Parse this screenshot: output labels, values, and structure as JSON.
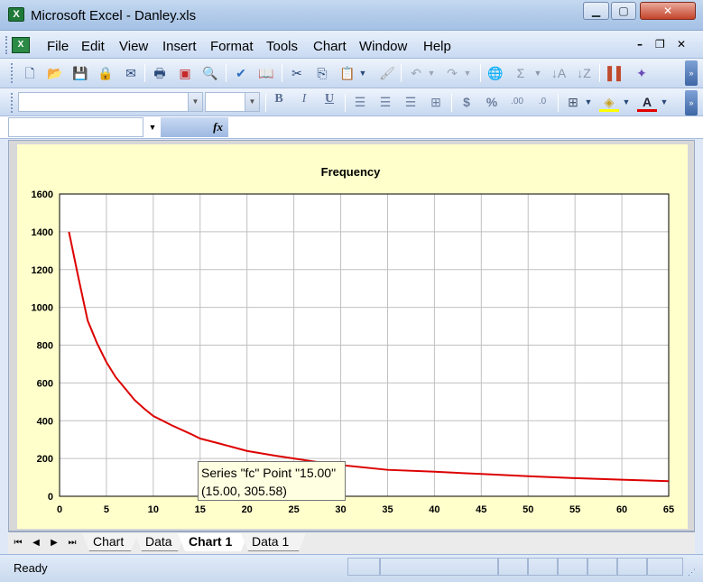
{
  "window": {
    "title": "Microsoft Excel - Danley.xls",
    "app_icon_glyph": "X"
  },
  "menu": {
    "items": [
      {
        "label": "File"
      },
      {
        "label": "Edit"
      },
      {
        "label": "View"
      },
      {
        "label": "Insert"
      },
      {
        "label": "Format"
      },
      {
        "label": "Tools"
      },
      {
        "label": "Chart"
      },
      {
        "label": "Window"
      },
      {
        "label": "Help"
      }
    ]
  },
  "formula_bar": {
    "name_box": "",
    "fx_label": "fx",
    "formula": ""
  },
  "toolbar": {
    "font_name": "",
    "font_size": "",
    "bold": "B",
    "italic": "I",
    "underline": "U",
    "currency": "$",
    "percent": "%",
    "increase_decimal": ".00",
    "decrease_decimal": ".0"
  },
  "tooltip": {
    "line1": "Series \"fc\" Point \"15.00\"",
    "line2": "(15.00, 305.58)"
  },
  "tabs": [
    {
      "label": "Chart",
      "active": false
    },
    {
      "label": "Data",
      "active": false
    },
    {
      "label": "Chart 1",
      "active": true
    },
    {
      "label": "Data 1",
      "active": false
    }
  ],
  "status": {
    "text": "Ready"
  },
  "colors": {
    "series": "#dd0000",
    "plot_bg": "#ffffff",
    "chart_bg": "#ffffcc",
    "grid": "#c0c0c0"
  },
  "chart_data": {
    "type": "line",
    "title": "Frequency",
    "xlabel": "",
    "ylabel": "",
    "xlim": [
      0,
      65
    ],
    "ylim": [
      0,
      1600
    ],
    "xticks": [
      0,
      5,
      10,
      15,
      20,
      25,
      30,
      35,
      40,
      45,
      50,
      55,
      60,
      65
    ],
    "yticks": [
      0,
      200,
      400,
      600,
      800,
      1000,
      1200,
      1400,
      1600
    ],
    "grid": true,
    "legend": "none",
    "series": [
      {
        "name": "fc",
        "x": [
          1,
          2,
          3,
          4,
          5,
          6,
          7,
          8,
          9,
          10,
          12,
          14,
          15,
          17,
          20,
          23,
          25,
          27,
          30,
          35,
          40,
          45,
          50,
          55,
          60,
          65
        ],
        "y": [
          1400,
          1160,
          930,
          810,
          710,
          630,
          570,
          510,
          465,
          425,
          375,
          330,
          305.58,
          280,
          240,
          215,
          200,
          185,
          165,
          140,
          130,
          118,
          106,
          96,
          88,
          80
        ]
      }
    ]
  }
}
